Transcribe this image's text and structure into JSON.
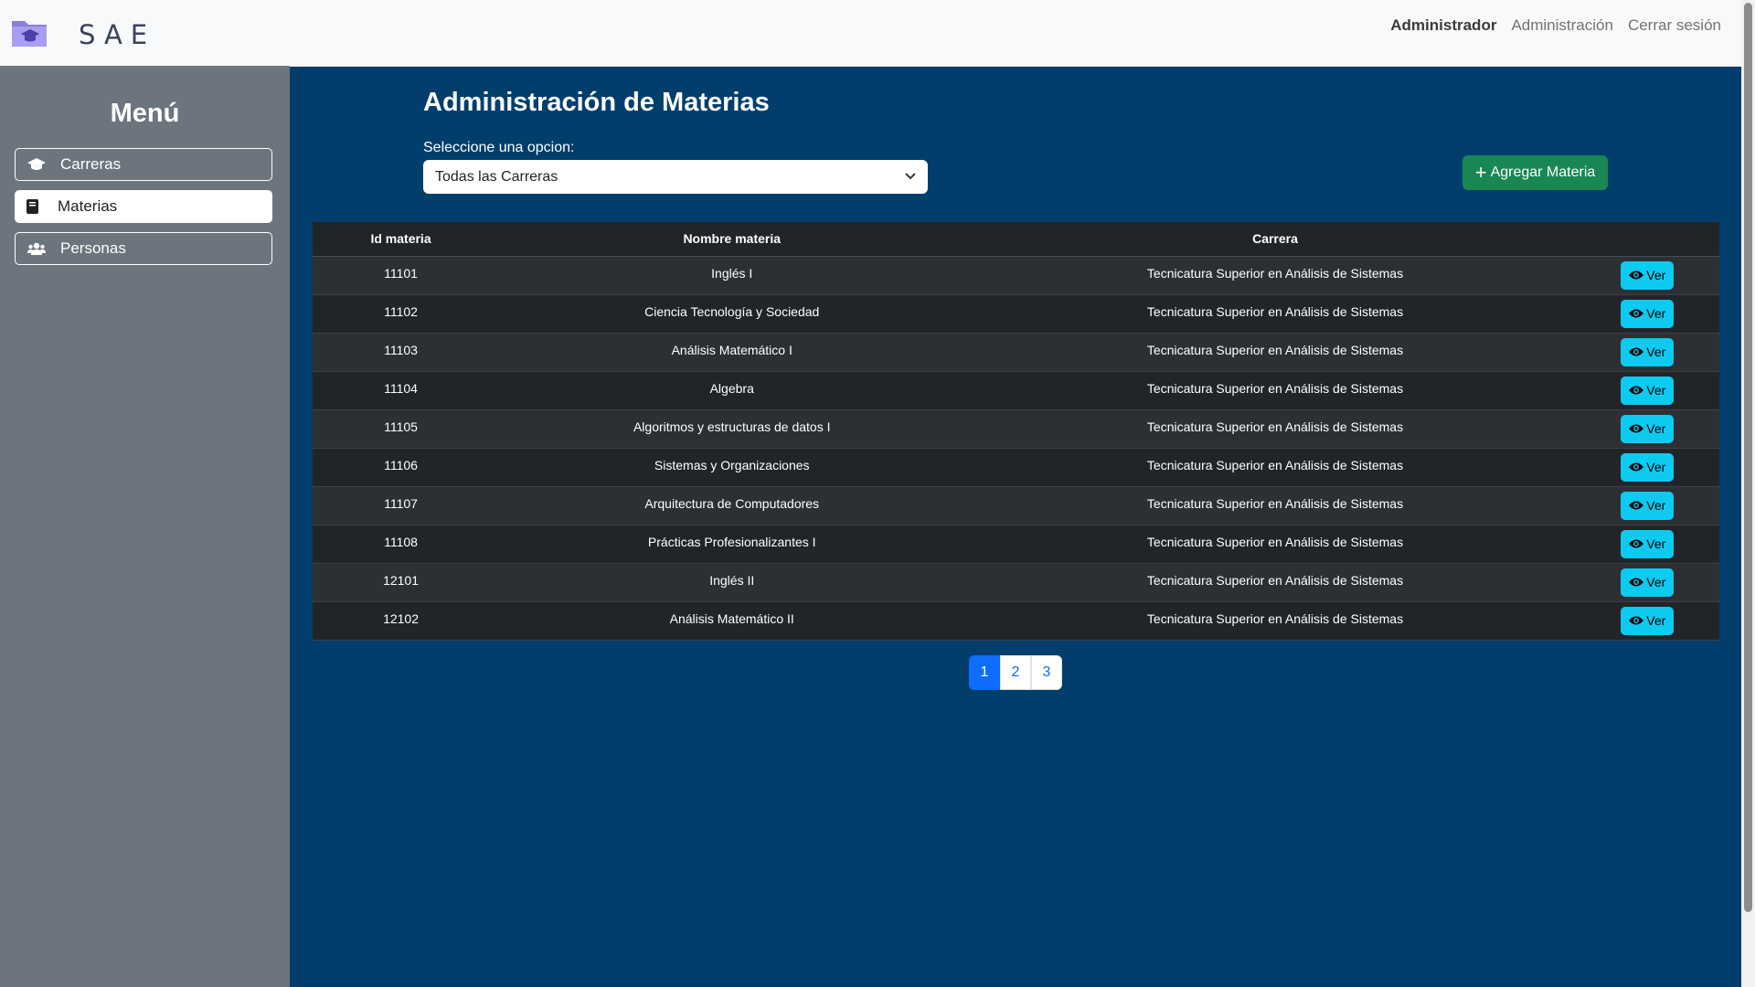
{
  "header": {
    "brand": "SAE",
    "user_label": "Administrador",
    "nav": [
      "Administración",
      "Cerrar sesión"
    ]
  },
  "sidebar": {
    "title": "Menú",
    "items": [
      {
        "label": "Carreras",
        "icon": "graduation-cap-icon",
        "active": false
      },
      {
        "label": "Materias",
        "icon": "book-icon",
        "active": true
      },
      {
        "label": "Personas",
        "icon": "users-icon",
        "active": false
      }
    ]
  },
  "main": {
    "title": "Administración de Materias",
    "select_label": "Seleccione una opcion:",
    "select_value": "Todas las Carreras",
    "add_button": "Agregar Materia",
    "table": {
      "headers": [
        "Id materia",
        "Nombre materia",
        "Carrera",
        ""
      ],
      "action_label": "Ver",
      "rows": [
        {
          "id": "11101",
          "nombre": "Inglés I",
          "carrera": "Tecnicatura Superior en Análisis de Sistemas"
        },
        {
          "id": "11102",
          "nombre": "Ciencia Tecnología y Sociedad",
          "carrera": "Tecnicatura Superior en Análisis de Sistemas"
        },
        {
          "id": "11103",
          "nombre": "Análisis Matemático I",
          "carrera": "Tecnicatura Superior en Análisis de Sistemas"
        },
        {
          "id": "11104",
          "nombre": "Algebra",
          "carrera": "Tecnicatura Superior en Análisis de Sistemas"
        },
        {
          "id": "11105",
          "nombre": "Algoritmos y estructuras de datos I",
          "carrera": "Tecnicatura Superior en Análisis de Sistemas"
        },
        {
          "id": "11106",
          "nombre": "Sistemas y Organizaciones",
          "carrera": "Tecnicatura Superior en Análisis de Sistemas"
        },
        {
          "id": "11107",
          "nombre": "Arquitectura de Computadores",
          "carrera": "Tecnicatura Superior en Análisis de Sistemas"
        },
        {
          "id": "11108",
          "nombre": "Prácticas Profesionalizantes I",
          "carrera": "Tecnicatura Superior en Análisis de Sistemas"
        },
        {
          "id": "12101",
          "nombre": "Inglés II",
          "carrera": "Tecnicatura Superior en Análisis de Sistemas"
        },
        {
          "id": "12102",
          "nombre": "Análisis Matemático II",
          "carrera": "Tecnicatura Superior en Análisis de Sistemas"
        }
      ]
    },
    "pagination": {
      "pages": [
        "1",
        "2",
        "3"
      ],
      "current": "1"
    }
  },
  "colors": {
    "background": "#013e6c",
    "sidebar": "#6c757d",
    "success": "#198754",
    "info": "#0dcaf0",
    "primary": "#0d6efd"
  }
}
